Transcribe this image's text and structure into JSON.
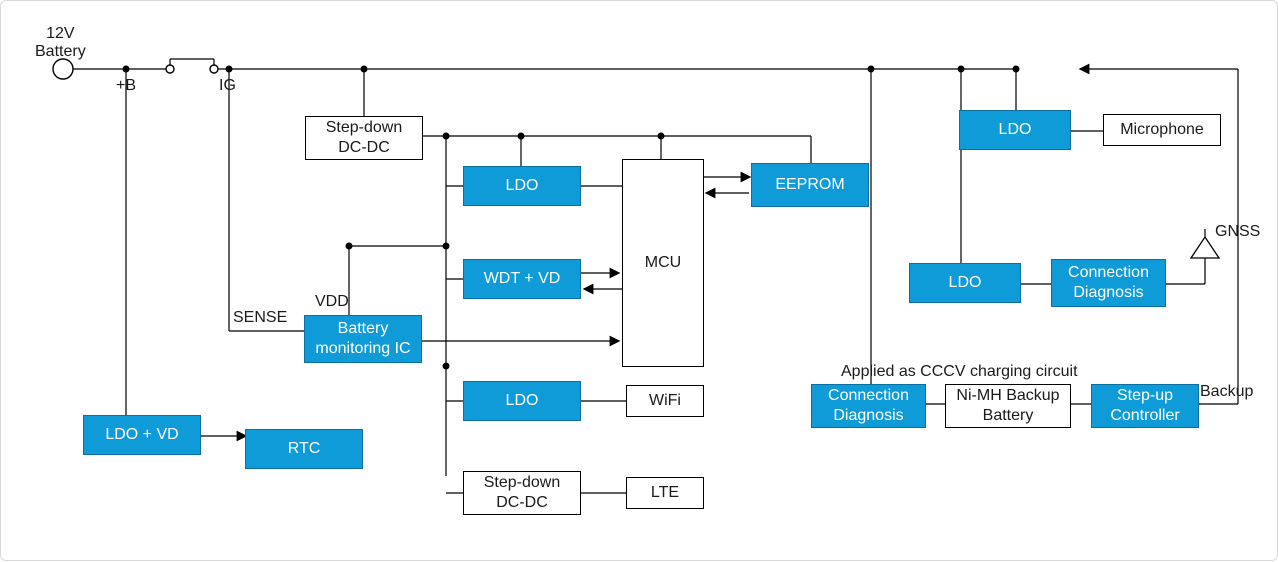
{
  "annotations": {
    "battery_12v": "12V\nBattery",
    "plus_b": "+B",
    "ig": "IG",
    "sense": "SENSE",
    "vdd": "VDD",
    "cccv": "Applied as CCCV charging circuit",
    "backup": "Backup",
    "gnss": "GNSS"
  },
  "blocks": {
    "stepdown1": "Step-down\nDC-DC",
    "ldo_mcu": "LDO",
    "wdt_vd": "WDT + VD",
    "batmon": "Battery\nmonitoring IC",
    "ldo_wifi": "LDO",
    "stepdown2": "Step-down\nDC-DC",
    "ldo_vd": "LDO + VD",
    "rtc": "RTC",
    "mcu": "MCU",
    "eeprom": "EEPROM",
    "wifi": "WiFi",
    "lte": "LTE",
    "ldo_mic": "LDO",
    "mic": "Microphone",
    "ldo_gnss": "LDO",
    "conn_diag_gnss": "Connection\nDiagnosis",
    "conn_diag_batt": "Connection\nDiagnosis",
    "nimh": "Ni-MH\nBackup Battery",
    "stepup": "Step-up\nController"
  }
}
